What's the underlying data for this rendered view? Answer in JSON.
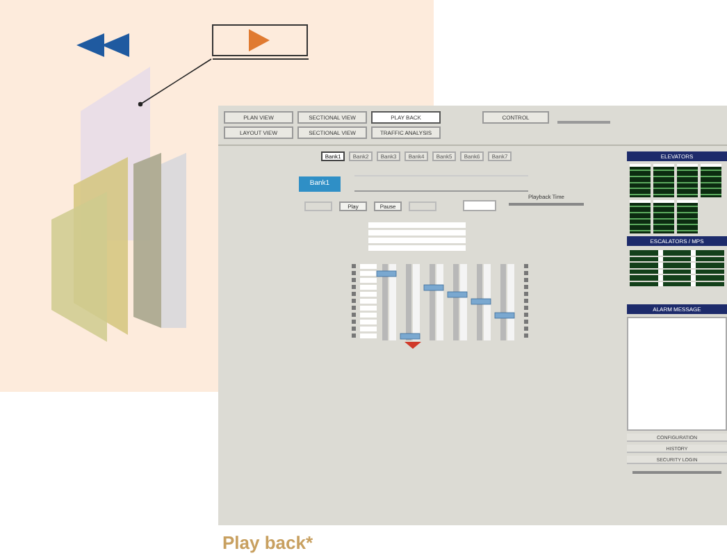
{
  "toolbar": {
    "buttons": [
      {
        "label": "PLAN VIEW",
        "selected": false
      },
      {
        "label": "SECTIONAL VIEW",
        "selected": false
      },
      {
        "label": "PLAY BACK",
        "selected": true
      },
      {
        "label": "LAYOUT VIEW",
        "selected": false
      },
      {
        "label": "SECTIONAL VIEW",
        "selected": false
      },
      {
        "label": "TRAFFIC ANALYSIS",
        "selected": false
      }
    ],
    "control": "CONTROL"
  },
  "tabs": [
    {
      "label": "Bank1",
      "selected": true
    },
    {
      "label": "Bank2",
      "selected": false
    },
    {
      "label": "Bank3",
      "selected": false
    },
    {
      "label": "Bank4",
      "selected": false
    },
    {
      "label": "Bank5",
      "selected": false
    },
    {
      "label": "Bank6",
      "selected": false
    },
    {
      "label": "Bank7",
      "selected": false
    }
  ],
  "bank_button": "Bank1",
  "playback_buttons": [
    {
      "label": "Play",
      "disabled": false
    },
    {
      "label": "Pause",
      "disabled": false
    }
  ],
  "playback_time_label": "Playback Time",
  "panels": {
    "elevators": "ELEVATORS",
    "escalators": "ESCALATORS / MPS",
    "alarm": "ALARM MESSAGE"
  },
  "bottom_buttons": [
    "CONFIGURATION",
    "HISTORY",
    "SECURITY LOGIN"
  ],
  "caption": "Play back*"
}
